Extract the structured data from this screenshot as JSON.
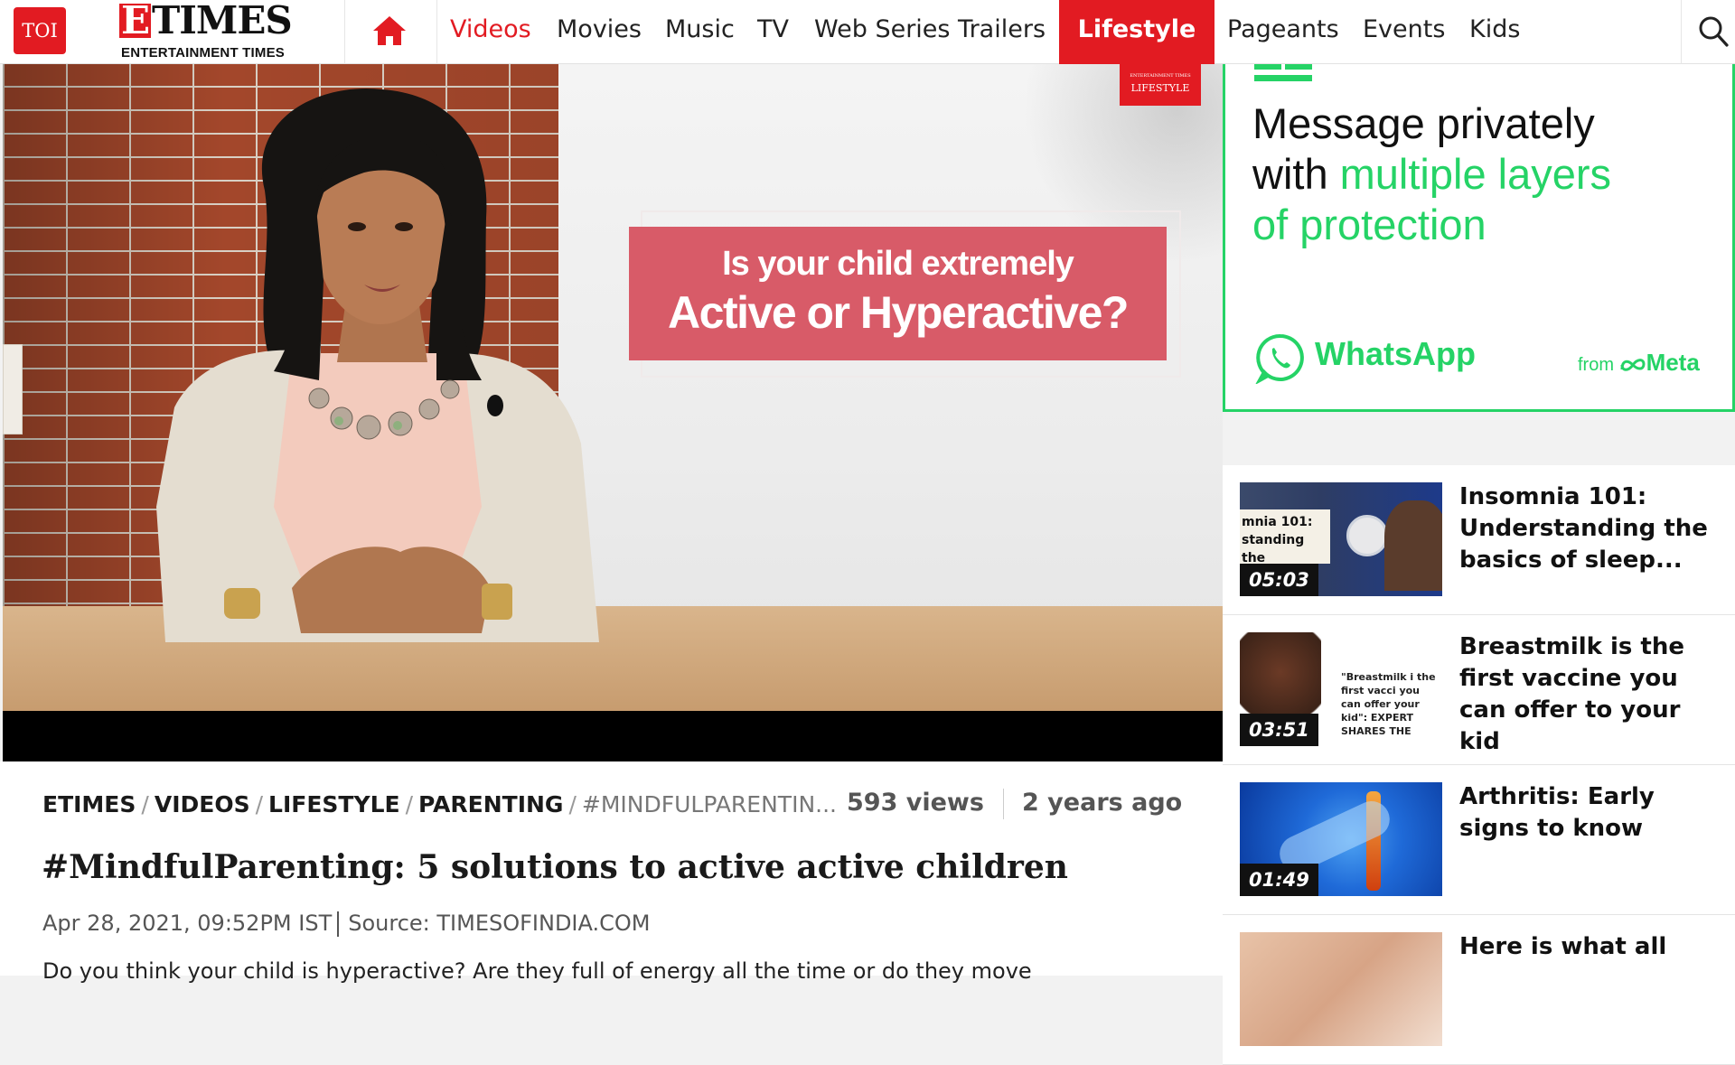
{
  "nav": {
    "toi": "TOI",
    "brand_letter": "E",
    "brand_rest": "TIMES",
    "brand_sub": "ENTERTAINMENT TIMES",
    "items": [
      "Videos",
      "Movies",
      "Music",
      "TV",
      "Web Series Trailers",
      "Lifestyle",
      "Pageants",
      "Events",
      "Kids"
    ],
    "accent": "#e21b22"
  },
  "video": {
    "card_line1": "Is your child extremely",
    "card_line2": "Active or Hyperactive?",
    "tag_top": "ENTERTAINMENT TIMES",
    "tag_main": "LIFESTYLE"
  },
  "meta": {
    "breadcrumb": [
      "ETIMES",
      "VIDEOS",
      "LIFESTYLE",
      "PARENTING",
      "#MINDFULPARENTIN..."
    ],
    "views": "593 views",
    "ago": "2 years ago",
    "headline": "#MindfulParenting: 5 solutions to active active children",
    "date": "Apr 28, 2021, 09:52PM IST",
    "source": "Source: TIMESOFINDIA.COM",
    "description": "Do you think your child is hyperactive? Are they full of energy all the time or do they move"
  },
  "ad": {
    "line1": "Message privately",
    "line2_a": "with ",
    "line2_b": "multiple layers",
    "line3": "of protection",
    "brand": "WhatsApp",
    "from": "from",
    "meta": "Meta",
    "color": "#25d366"
  },
  "related": [
    {
      "title": "Insomnia 101: Understanding the basics of sleep...",
      "duration": "05:03",
      "thumb_text": "mnia 101: standing the"
    },
    {
      "title": "Breastmilk is the first vaccine you can offer to your kid",
      "duration": "03:51",
      "thumb_text": "\"Breastmilk i the first vacci you can offer your kid\": EXPERT SHARES THE"
    },
    {
      "title": "Arthritis: Early signs to know",
      "duration": "01:49",
      "thumb_text": ""
    },
    {
      "title": "Here is what all",
      "duration": "",
      "thumb_text": ""
    }
  ]
}
